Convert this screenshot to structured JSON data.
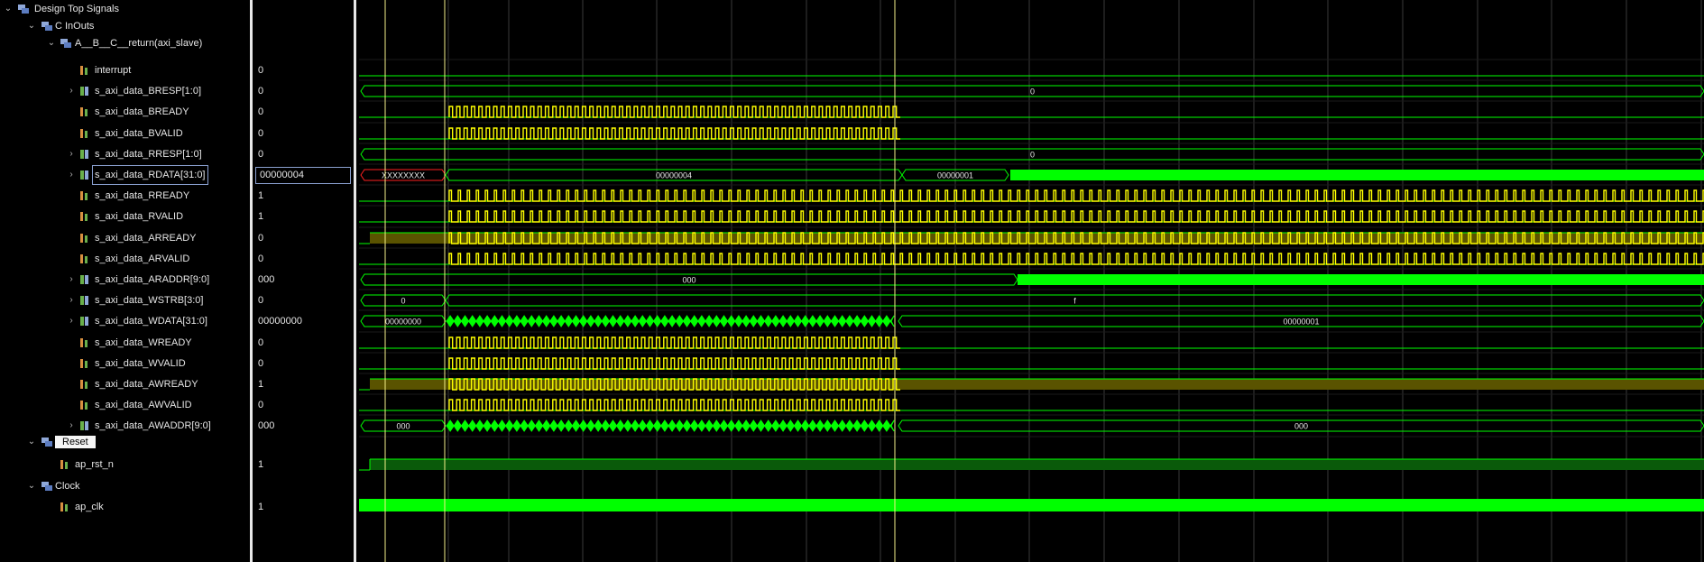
{
  "tree": {
    "root": {
      "label": "Design Top Signals"
    },
    "group_inouts": {
      "label": "C InOuts"
    },
    "group_axi": {
      "label": "A__B__C__return(axi_slave)"
    },
    "group_reset": {
      "label": "Reset"
    },
    "group_clock": {
      "label": "Clock"
    }
  },
  "signals": [
    {
      "name": "interrupt",
      "value": "0"
    },
    {
      "name": "s_axi_data_BRESP[1:0]",
      "value": "0",
      "bus_value": "0"
    },
    {
      "name": "s_axi_data_BREADY",
      "value": "0"
    },
    {
      "name": "s_axi_data_BVALID",
      "value": "0"
    },
    {
      "name": "s_axi_data_RRESP[1:0]",
      "value": "0",
      "bus_value": "0"
    },
    {
      "name": "s_axi_data_RDATA[31:0]",
      "value": "00000004",
      "bus_values": [
        "XXXXXXXX",
        "00000004",
        "00000001"
      ]
    },
    {
      "name": "s_axi_data_RREADY",
      "value": "1"
    },
    {
      "name": "s_axi_data_RVALID",
      "value": "1"
    },
    {
      "name": "s_axi_data_ARREADY",
      "value": "0"
    },
    {
      "name": "s_axi_data_ARVALID",
      "value": "0"
    },
    {
      "name": "s_axi_data_ARADDR[9:0]",
      "value": "000",
      "bus_value": "000"
    },
    {
      "name": "s_axi_data_WSTRB[3:0]",
      "value": "0",
      "bus_values": [
        "0",
        "f"
      ]
    },
    {
      "name": "s_axi_data_WDATA[31:0]",
      "value": "00000000",
      "bus_values": [
        "00000000",
        "00000001"
      ]
    },
    {
      "name": "s_axi_data_WREADY",
      "value": "0"
    },
    {
      "name": "s_axi_data_WVALID",
      "value": "0"
    },
    {
      "name": "s_axi_data_AWREADY",
      "value": "1"
    },
    {
      "name": "s_axi_data_AWVALID",
      "value": "0"
    },
    {
      "name": "s_axi_data_AWADDR[9:0]",
      "value": "000",
      "bus_values": [
        "000",
        "000"
      ]
    }
  ],
  "reset_signal": {
    "name": "ap_rst_n",
    "value": "1"
  },
  "clock_signal": {
    "name": "ap_clk",
    "value": "1"
  },
  "colors": {
    "wave_green": "#00ff00",
    "wave_yellow": "#ffff00",
    "highlight_fill": "#5a5300",
    "x_state": "#ff2020"
  },
  "icons": {
    "bus": "bus-signal-icon",
    "bit": "bit-signal-icon",
    "group": "signal-group-icon"
  }
}
